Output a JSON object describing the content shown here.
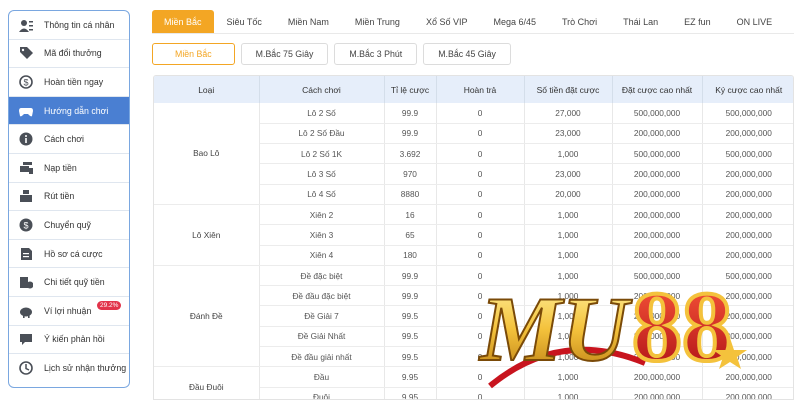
{
  "sidebar": {
    "items": [
      {
        "label": "Thông tin cá nhân",
        "icon": "user-list-icon"
      },
      {
        "label": "Mã đổi thưởng",
        "icon": "tag-icon"
      },
      {
        "label": "Hoàn tiền ngay",
        "icon": "refund-icon"
      },
      {
        "label": "Hướng dẫn chơi",
        "icon": "gamepad-icon",
        "active": true
      },
      {
        "label": "Cách chơi",
        "icon": "info-icon"
      },
      {
        "label": "Nạp tiền",
        "icon": "deposit-icon"
      },
      {
        "label": "Rút tiền",
        "icon": "withdraw-icon"
      },
      {
        "label": "Chuyển quỹ",
        "icon": "transfer-coin-icon"
      },
      {
        "label": "Hồ sơ cá cược",
        "icon": "document-icon"
      },
      {
        "label": "Chi tiết quỹ tiền",
        "icon": "money-detail-icon"
      },
      {
        "label": "Ví lợi nhuận",
        "icon": "piggy-bank-icon",
        "badge": "29.2%"
      },
      {
        "label": "Ý kiến phản hồi",
        "icon": "chat-icon"
      },
      {
        "label": "Lịch sử nhận thưởng",
        "icon": "history-icon"
      }
    ]
  },
  "tabs": [
    "Miền Bắc",
    "Siêu Tốc",
    "Miền Nam",
    "Miền Trung",
    "Xổ Số VIP",
    "Mega 6/45",
    "Trò Chơi",
    "Thái Lan",
    "EZ fun",
    "ON LIVE"
  ],
  "subtabs": [
    "Miền Bắc",
    "M.Bắc 75 Giây",
    "M.Bắc 3 Phút",
    "M.Bắc 45 Giây"
  ],
  "table": {
    "headers": [
      "Loại",
      "Cách chơi",
      "Tỉ lệ cược",
      "Hoàn trả",
      "Số tiền đặt cược",
      "Đặt cược cao nhất",
      "Ký cược cao nhất"
    ],
    "groups": [
      {
        "type": "Bao Lô",
        "rows": [
          [
            "Lô 2 Số",
            "99.9",
            "0",
            "27,000",
            "500,000,000",
            "500,000,000"
          ],
          [
            "Lô 2 Số Đầu",
            "99.9",
            "0",
            "23,000",
            "200,000,000",
            "200,000,000"
          ],
          [
            "Lô 2 Số 1K",
            "3.692",
            "0",
            "1,000",
            "500,000,000",
            "500,000,000"
          ],
          [
            "Lô 3 Số",
            "970",
            "0",
            "23,000",
            "200,000,000",
            "200,000,000"
          ],
          [
            "Lô 4 Số",
            "8880",
            "0",
            "20,000",
            "200,000,000",
            "200,000,000"
          ]
        ]
      },
      {
        "type": "Lô Xiên",
        "rows": [
          [
            "Xiên 2",
            "16",
            "0",
            "1,000",
            "200,000,000",
            "200,000,000"
          ],
          [
            "Xiên 3",
            "65",
            "0",
            "1,000",
            "200,000,000",
            "200,000,000"
          ],
          [
            "Xiên 4",
            "180",
            "0",
            "1,000",
            "200,000,000",
            "200,000,000"
          ]
        ]
      },
      {
        "type": "Đánh Đề",
        "rows": [
          [
            "Đề đặc biệt",
            "99.9",
            "0",
            "1,000",
            "500,000,000",
            "500,000,000"
          ],
          [
            "Đề đầu đặc biệt",
            "99.9",
            "0",
            "1,000",
            "200,000,000",
            "200,000,000"
          ],
          [
            "Đề Giải 7",
            "99.5",
            "0",
            "1,000",
            "200,000,000",
            "200,000,000"
          ],
          [
            "Đề Giải Nhất",
            "99.5",
            "0",
            "1,000",
            "200,000,000",
            "200,000,000"
          ],
          [
            "Đề đầu giải nhất",
            "99.5",
            "0",
            "1,000",
            "200,000,000",
            "200,000,000"
          ]
        ]
      },
      {
        "type": "Đầu Đuôi",
        "rows": [
          [
            "Đầu",
            "9.95",
            "0",
            "1,000",
            "200,000,000",
            "200,000,000"
          ],
          [
            "Đuôi",
            "9.95",
            "0",
            "1,000",
            "200,000,000",
            "200,000,000"
          ]
        ]
      }
    ]
  },
  "logo": {
    "text_mu": "MU",
    "text_88": "88"
  },
  "colors": {
    "accent": "#f3a624",
    "active_sidebar": "#4a7fd2",
    "header_bg": "#e6eefa",
    "logo_red": "#c8141e",
    "logo_gold": "#f4c23c"
  }
}
